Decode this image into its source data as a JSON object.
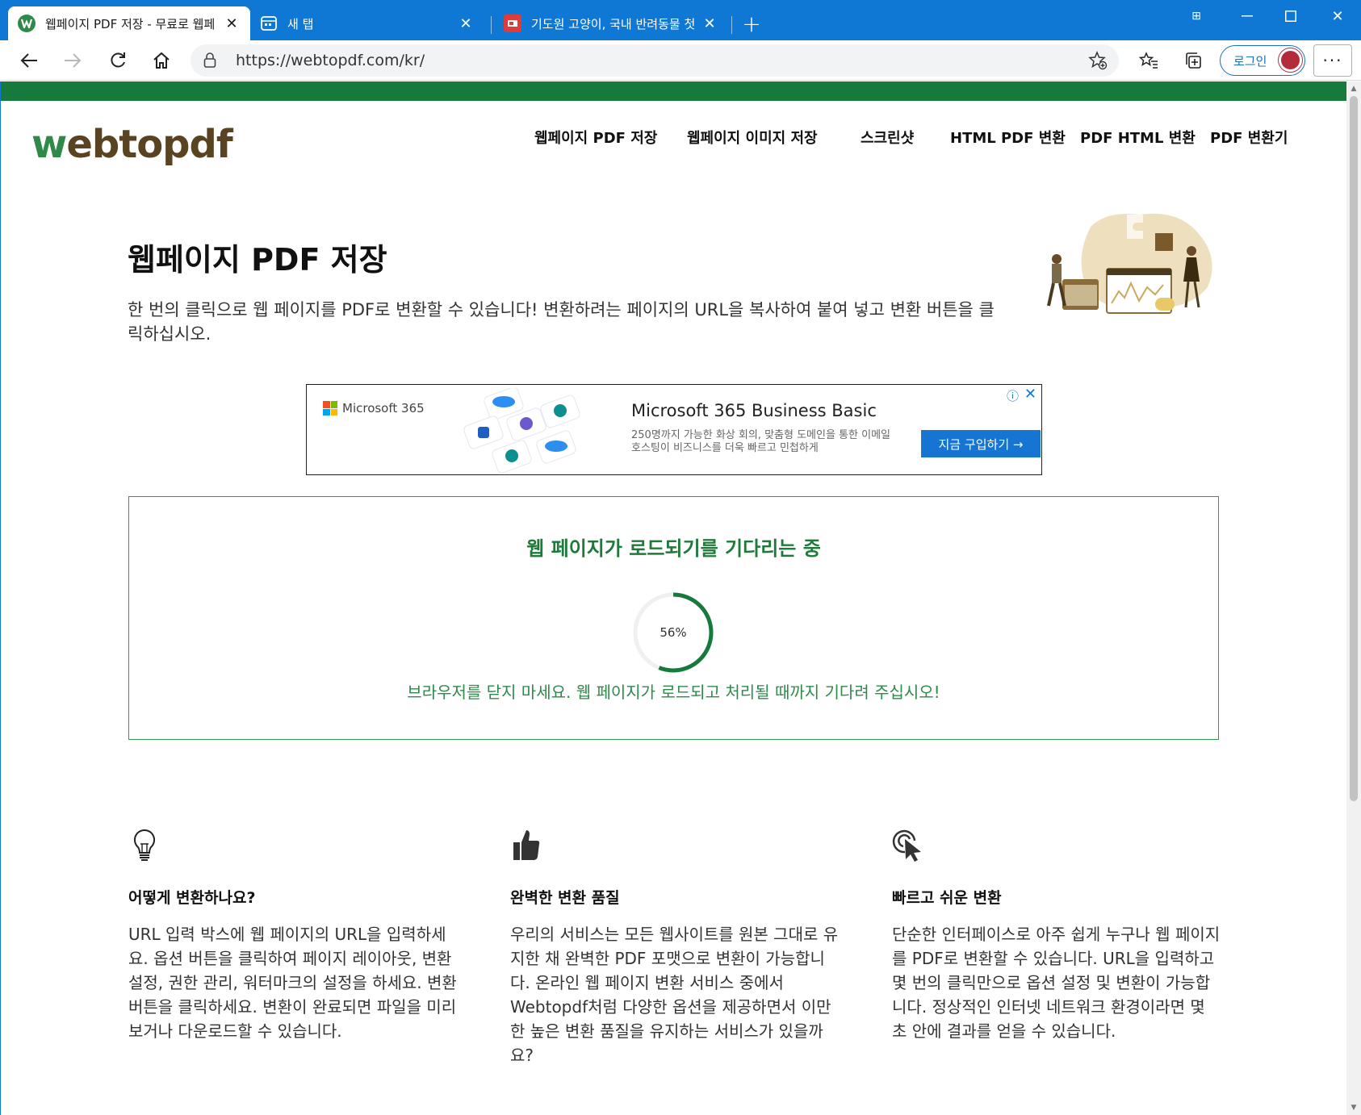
{
  "browser": {
    "tabs": [
      {
        "title": "웹페이지 PDF 저장 - 무료로 웹페",
        "active": true
      },
      {
        "title": "새 탭",
        "active": false
      },
      {
        "title": "기도원 고양이, 국내 반려동물 첫",
        "active": false
      }
    ],
    "address": "https://webtopdf.com/kr/",
    "login_label": "로그인",
    "more_label": "···"
  },
  "site": {
    "logo_w": "w",
    "logo_rest": "ebtopdf",
    "nav": [
      "웹페이지 PDF 저장",
      "웹페이지 이미지 저장",
      "스크린샷",
      "HTML PDF 변환",
      "PDF HTML 변환",
      "PDF 변환기"
    ],
    "accent_color": "#157a3c"
  },
  "hero": {
    "title": "웹페이지 PDF 저장",
    "description": "한 번의 클릭으로 웹 페이지를 PDF로 변환할 수 있습니다! 변환하려는 페이지의 URL을 복사하여 붙여 넣고 변환 버튼을 클릭하십시오."
  },
  "ad": {
    "brand": "Microsoft 365",
    "title": "Microsoft 365 Business Basic",
    "description": "250명까지 가능한 화상 회의, 맞춤형 도메인을 통한 이메일 호스팅이 비즈니스를 더욱 빠르고 민첩하게",
    "button": "지금 구입하기 →"
  },
  "loading": {
    "title": "웹 페이지가 로드되기를 기다리는 중",
    "percent": 56,
    "percent_label": "56%",
    "note": "브라우저를 닫지 마세요. 웹 페이지가 로드되고 처리될 때까지 기다려 주십시오!"
  },
  "features": [
    {
      "icon": "lightbulb-icon",
      "title": "어떻게 변환하나요?",
      "text": "URL 입력 박스에 웹 페이지의 URL을 입력하세요. 옵션 버튼을 클릭하여 페이지 레이아웃, 변환 설정, 권한 관리, 워터마크의 설정을 하세요. 변환 버튼을 클릭하세요. 변환이 완료되면 파일을 미리 보거나 다운로드할 수 있습니다."
    },
    {
      "icon": "thumbs-up-icon",
      "title": "완벽한 변환 품질",
      "text": "우리의 서비스는 모든 웹사이트를 원본 그대로 유지한 채 완벽한 PDF 포맷으로 변환이 가능합니다. 온라인 웹 페이지 변환 서비스 중에서 Webtopdf처럼 다양한 옵션을 제공하면서 이만한 높은 변환 품질을 유지하는 서비스가 있을까요?"
    },
    {
      "icon": "click-cursor-icon",
      "title": "빠르고 쉬운 변환",
      "text": "단순한 인터페이스로 아주 쉽게 누구나 웹 페이지를 PDF로 변환할 수 있습니다. URL을 입력하고 몇 번의 클릭만으로 옵션 설정 및 변환이 가능합니다. 정상적인 인터넷 네트워크 환경이라면 몇 초 안에 결과를 얻을 수 있습니다."
    }
  ]
}
